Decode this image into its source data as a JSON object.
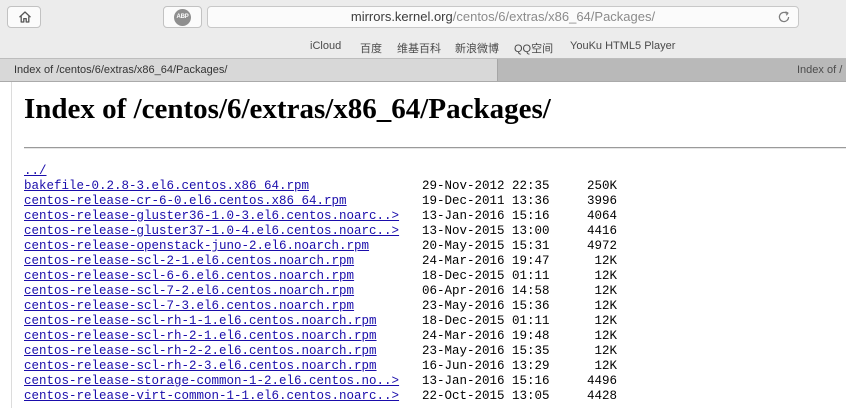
{
  "browser": {
    "url_host": "mirrors.kernel.org",
    "url_path": "/centos/6/extras/x86_64/Packages/",
    "favorites": [
      "iCloud",
      "百度",
      "维基百科",
      "新浪微博",
      "QQ空间",
      "YouKu HTML5 Player"
    ],
    "tabs": [
      {
        "title": "Index of /centos/6/extras/x86_64/Packages/",
        "active": true
      },
      {
        "title": "Index of /",
        "active": false
      }
    ],
    "abp_label": "ABP"
  },
  "page": {
    "heading": "Index of /centos/6/extras/x86_64/Packages/",
    "entries": [
      {
        "name": "../",
        "date": "",
        "size": ""
      },
      {
        "name": "bakefile-0.2.8-3.el6.centos.x86_64.rpm",
        "date": "29-Nov-2012 22:35",
        "size": "250K"
      },
      {
        "name": "centos-release-cr-6-0.el6.centos.x86_64.rpm",
        "date": "19-Dec-2011 13:36",
        "size": "3996"
      },
      {
        "name": "centos-release-gluster36-1.0-3.el6.centos.noarc..>",
        "date": "13-Jan-2016 15:16",
        "size": "4064"
      },
      {
        "name": "centos-release-gluster37-1.0-4.el6.centos.noarc..>",
        "date": "13-Nov-2015 13:00",
        "size": "4416"
      },
      {
        "name": "centos-release-openstack-juno-2.el6.noarch.rpm",
        "date": "20-May-2015 15:31",
        "size": "4972"
      },
      {
        "name": "centos-release-scl-2-1.el6.centos.noarch.rpm",
        "date": "24-Mar-2016 19:47",
        "size": "12K"
      },
      {
        "name": "centos-release-scl-6-6.el6.centos.noarch.rpm",
        "date": "18-Dec-2015 01:11",
        "size": "12K"
      },
      {
        "name": "centos-release-scl-7-2.el6.centos.noarch.rpm",
        "date": "06-Apr-2016 14:58",
        "size": "12K"
      },
      {
        "name": "centos-release-scl-7-3.el6.centos.noarch.rpm",
        "date": "23-May-2016 15:36",
        "size": "12K"
      },
      {
        "name": "centos-release-scl-rh-1-1.el6.centos.noarch.rpm",
        "date": "18-Dec-2015 01:11",
        "size": "12K"
      },
      {
        "name": "centos-release-scl-rh-2-1.el6.centos.noarch.rpm",
        "date": "24-Mar-2016 19:48",
        "size": "12K"
      },
      {
        "name": "centos-release-scl-rh-2-2.el6.centos.noarch.rpm",
        "date": "23-May-2016 15:35",
        "size": "12K"
      },
      {
        "name": "centos-release-scl-rh-2-3.el6.centos.noarch.rpm",
        "date": "16-Jun-2016 13:29",
        "size": "12K"
      },
      {
        "name": "centos-release-storage-common-1-2.el6.centos.no..>",
        "date": "13-Jan-2016 15:16",
        "size": "4496"
      },
      {
        "name": "centos-release-virt-common-1-1.el6.centos.noarc..>",
        "date": "22-Oct-2015 13:05",
        "size": "4428"
      }
    ]
  }
}
